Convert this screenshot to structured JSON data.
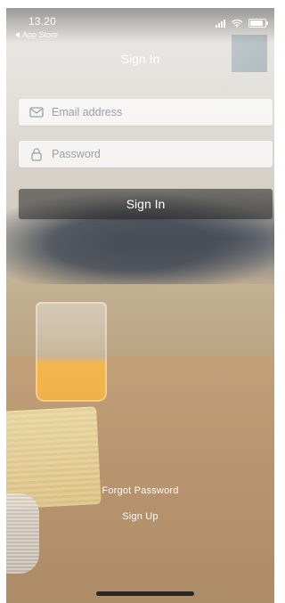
{
  "status_bar": {
    "time": "13.20",
    "back_app": "App Store",
    "icons": [
      "signal-icon",
      "wifi-icon",
      "battery-icon"
    ],
    "battery_level": 0.85
  },
  "screen": {
    "title": "Sign In"
  },
  "form": {
    "email": {
      "placeholder": "Email address",
      "value": "",
      "icon": "envelope-icon"
    },
    "password": {
      "placeholder": "Password",
      "value": "",
      "icon": "lock-icon"
    },
    "signin_button_label": "Sign In"
  },
  "links": {
    "forgot_password": "Forgot Password",
    "sign_up": "Sign Up"
  },
  "colors": {
    "text_light": "#ffffff",
    "field_bg": "rgba(255,255,255,0.72)",
    "button_bg": "rgba(32,32,32,0.55)"
  }
}
